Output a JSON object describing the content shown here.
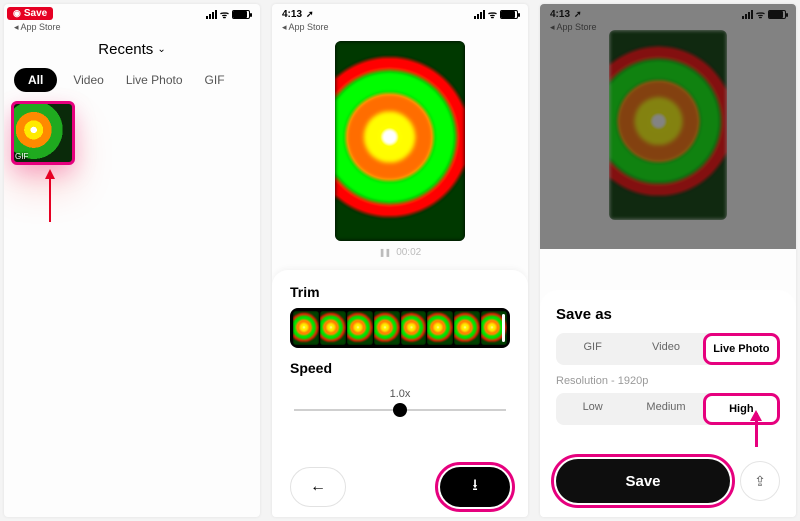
{
  "statusbar": {
    "time": "4:13",
    "back_label": "App Store"
  },
  "pin": {
    "label": "Save"
  },
  "screen1": {
    "title": "Recents",
    "tabs": {
      "all": "All",
      "video": "Video",
      "live": "Live Photo",
      "gif": "GIF"
    },
    "thumb_badge": "GIF"
  },
  "screen2": {
    "playback_time": "00:02",
    "trim_label": "Trim",
    "speed_label": "Speed",
    "speed_value": "1.0x"
  },
  "screen3": {
    "sheet_title": "Save as",
    "format": {
      "gif": "GIF",
      "video": "Video",
      "live": "Live Photo",
      "selected": "Live Photo"
    },
    "resolution_label": "Resolution - 1920p",
    "quality": {
      "low": "Low",
      "medium": "Medium",
      "high": "High",
      "selected": "High"
    },
    "save_label": "Save"
  }
}
